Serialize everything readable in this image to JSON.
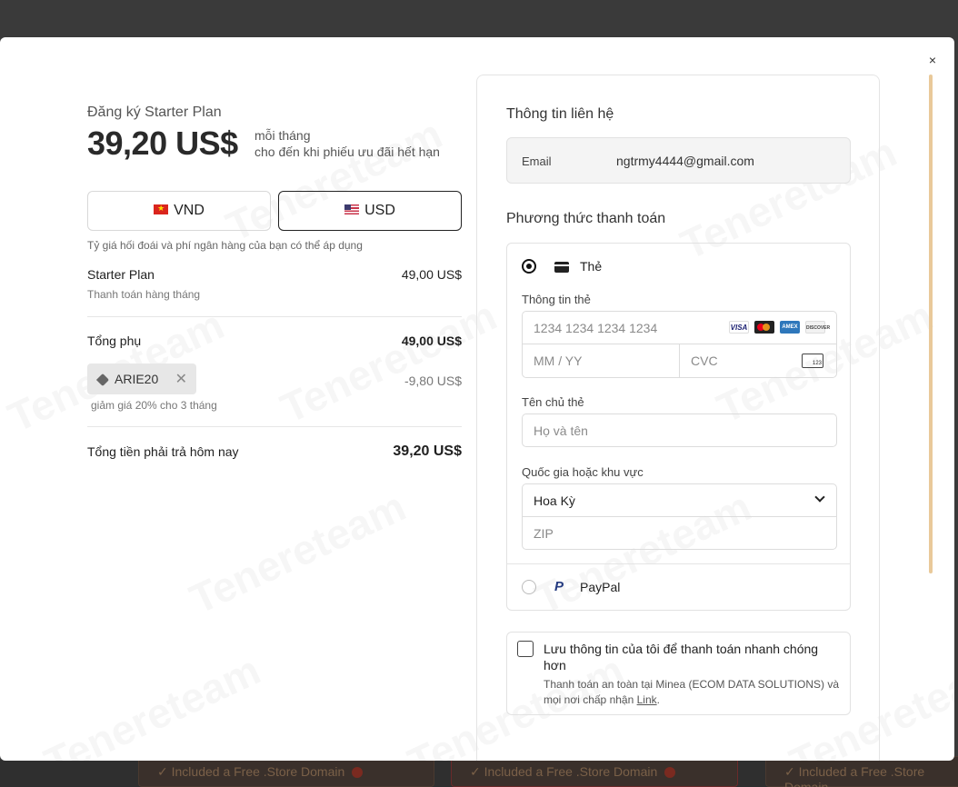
{
  "plan": {
    "subtitle": "Đăng ký Starter Plan",
    "price": "39,20 US$",
    "period_line1": "mỗi tháng",
    "period_line2": "cho đến khi phiếu ưu đãi hết hạn"
  },
  "currency": {
    "options": [
      "VND",
      "USD"
    ],
    "selected": "USD",
    "note": "Tỷ giá hối đoái và phí ngân hàng của bạn có thể áp dụng"
  },
  "summary": {
    "item_name": "Starter Plan",
    "item_price": "49,00 US$",
    "item_billing": "Thanh toán hàng tháng",
    "subtotal_label": "Tổng phụ",
    "subtotal_value": "49,00 US$",
    "coupon_code": "ARIE20",
    "coupon_discount": "-9,80 US$",
    "coupon_desc": "giảm giá 20% cho 3 tháng",
    "total_label": "Tổng tiền phải trả hôm nay",
    "total_value": "39,20 US$"
  },
  "contact": {
    "title": "Thông tin liên hệ",
    "email_label": "Email",
    "email_value": "ngtrmy4444@gmail.com"
  },
  "payment": {
    "title": "Phương thức thanh toán",
    "card_option_label": "Thẻ",
    "card_info_label": "Thông tin thẻ",
    "card_number_placeholder": "1234 1234 1234 1234",
    "expiry_placeholder": "MM / YY",
    "cvc_placeholder": "CVC",
    "cvc_icon_text": "123",
    "brands": [
      "VISA",
      "mastercard",
      "AMEX",
      "DISCOVER"
    ],
    "cardholder_label": "Tên chủ thẻ",
    "cardholder_placeholder": "Họ và tên",
    "country_label": "Quốc gia hoặc khu vực",
    "country_value": "Hoa Kỳ",
    "zip_placeholder": "ZIP",
    "paypal_label": "PayPal"
  },
  "save_info": {
    "label": "Lưu thông tin của tôi để thanh toán nhanh chóng hơn",
    "desc": "Thanh toán an toàn tại Minea (ECOM DATA SOLUTIONS) và mọi nơi chấp nhận",
    "link": "Link",
    "link_suffix": "."
  },
  "close_label": "×",
  "background": {
    "card_text": "Included a Free .Store Domain"
  },
  "watermark": "Tenereteam",
  "colors": {
    "scrollbar": "#e9c99a",
    "field_border": "#dcdcdc",
    "text_dark": "#1f1f1f"
  }
}
